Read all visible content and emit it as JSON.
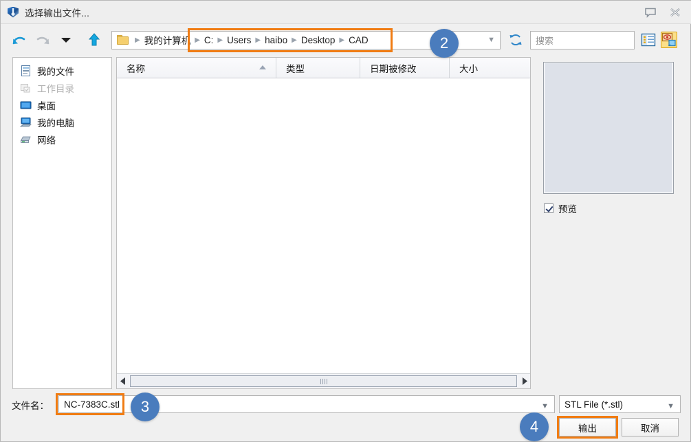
{
  "window": {
    "title": "选择输出文件...",
    "app_icon": "shield-tool-icon",
    "help_icon": "help-balloon-icon",
    "close_icon": "close-icon"
  },
  "toolbar": {
    "back_icon": "back-arrow-icon",
    "forward_icon": "forward-arrow-icon",
    "history_icon": "chevron-down-icon",
    "up_icon": "up-arrow-icon",
    "refresh_icon": "refresh-icon",
    "breadcrumb": {
      "folder_icon": "folder-icon",
      "root": "我的计算机",
      "items": [
        "C:",
        "Users",
        "haibo",
        "Desktop",
        "CAD"
      ],
      "dropdown_icon": "chevron-down-icon"
    },
    "search": {
      "placeholder": "搜索",
      "value": ""
    },
    "views": [
      {
        "name": "detail-view-icon",
        "active": false
      },
      {
        "name": "preview-view-icon",
        "active": true
      }
    ]
  },
  "sidebar": {
    "items": [
      {
        "label": "我的文件",
        "icon": "document-icon",
        "disabled": false
      },
      {
        "label": "工作目录",
        "icon": "working-folder-icon",
        "disabled": true
      },
      {
        "label": "桌面",
        "icon": "desktop-icon",
        "disabled": false
      },
      {
        "label": "我的电脑",
        "icon": "computer-icon",
        "disabled": false
      },
      {
        "label": "网络",
        "icon": "network-icon",
        "disabled": false
      }
    ]
  },
  "filelist": {
    "columns": [
      {
        "label": "名称",
        "sort": "asc"
      },
      {
        "label": "类型",
        "sort": ""
      },
      {
        "label": "日期被修改",
        "sort": ""
      },
      {
        "label": "大小",
        "sort": ""
      }
    ],
    "rows": [],
    "scrollbar": {
      "left_icon": "scroll-left-icon",
      "right_icon": "scroll-right-icon",
      "grip_icon": "scroll-grip-icon"
    }
  },
  "preview": {
    "checkbox_label": "预览",
    "checked": true
  },
  "bottom": {
    "filename_label": "文件名：",
    "filename_value": "NC-7383C.stl",
    "filename_dropdown_icon": "chevron-down-icon",
    "filetype_value": "STL File (*.stl)",
    "filetype_dropdown_icon": "chevron-down-icon",
    "export_label": "输出",
    "cancel_label": "取消"
  },
  "badges": [
    {
      "number": "2"
    },
    {
      "number": "3"
    },
    {
      "number": "4"
    }
  ],
  "colors": {
    "highlight": "#f07c13",
    "badge": "#4a7cbd",
    "titlebar": "#eeeeee",
    "window_bg": "#f0f0f0"
  }
}
